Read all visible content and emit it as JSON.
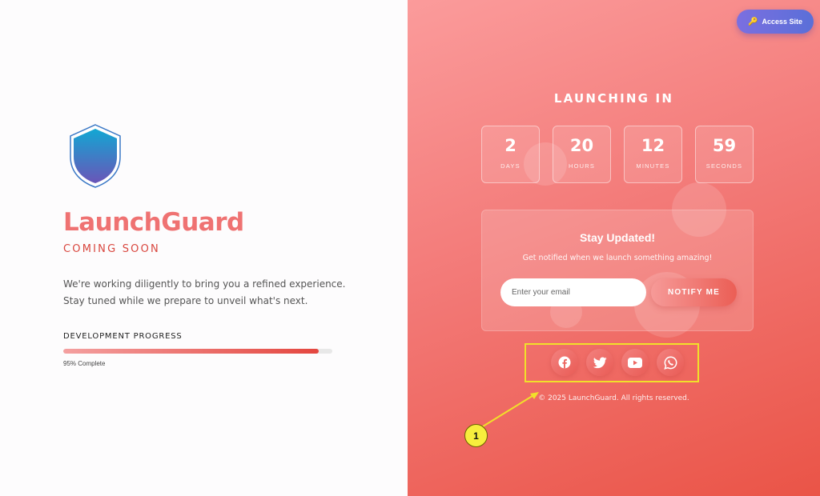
{
  "brand": {
    "name": "LaunchGuard",
    "tagline": "COMING SOON",
    "description_line1": "We're working diligently to bring you a refined experience.",
    "description_line2": "Stay tuned while we prepare to unveil what's next.",
    "logo_icon": "shield-icon"
  },
  "progress": {
    "title": "DEVELOPMENT PROGRESS",
    "value_percent": 95,
    "label": "95% Complete"
  },
  "header": {
    "access_label": "Access Site",
    "access_icon": "key-icon"
  },
  "countdown": {
    "title": "LAUNCHING IN",
    "units": [
      {
        "value": "2",
        "label": "DAYS"
      },
      {
        "value": "20",
        "label": "HOURS"
      },
      {
        "value": "12",
        "label": "MINUTES"
      },
      {
        "value": "59",
        "label": "SECONDS"
      }
    ]
  },
  "subscribe": {
    "title": "Stay Updated!",
    "subtitle": "Get notified when we launch something amazing!",
    "email_placeholder": "Enter your email",
    "button_label": "NOTIFY ME"
  },
  "social": [
    {
      "icon": "facebook-icon"
    },
    {
      "icon": "twitter-icon"
    },
    {
      "icon": "youtube-icon"
    },
    {
      "icon": "whatsapp-icon"
    }
  ],
  "footer": {
    "copyright": "© 2025 LaunchGuard. All rights reserved."
  },
  "annotation": {
    "callout_number": "1"
  },
  "colors": {
    "brand_text": "#ef7272",
    "accent_red": "#e4463f",
    "right_panel_start": "#fb9b9b",
    "right_panel_end": "#ea5447",
    "access_button": "#6a6fdc",
    "highlight_box": "#f1e02a"
  }
}
